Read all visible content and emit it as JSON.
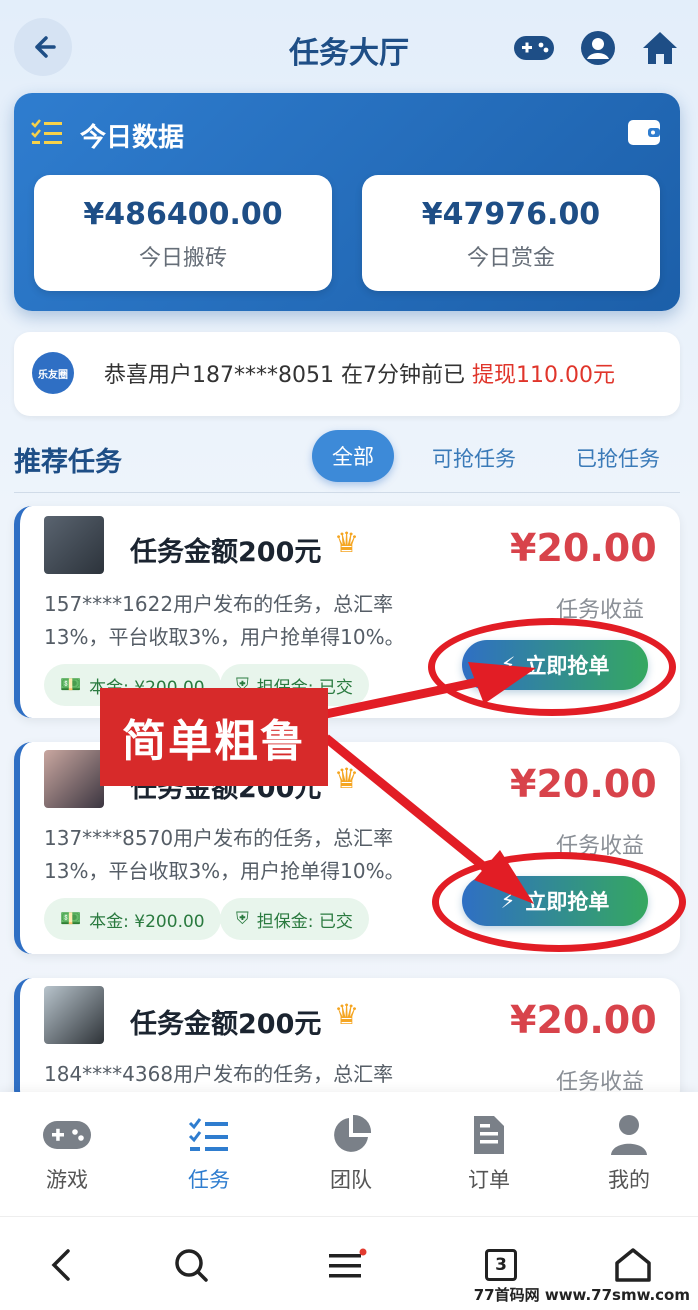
{
  "header": {
    "title": "任务大厅"
  },
  "stats": {
    "title": "今日数据",
    "items": [
      {
        "value": "¥486400.00",
        "label": "今日搬砖"
      },
      {
        "value": "¥47976.00",
        "label": "今日赏金"
      }
    ]
  },
  "notice": {
    "logo_text": "乐友圈",
    "text": "恭喜用户187****8051 在7分钟前已 ",
    "highlight": "提现110.00元"
  },
  "section": {
    "title": "推荐任务",
    "tabs": [
      "全部",
      "可抢任务",
      "已抢任务"
    ]
  },
  "tasks": [
    {
      "title": "任务金额200元",
      "price": "¥20.00",
      "earn_label": "任务收益",
      "desc": "157****1622用户发布的任务，总汇率13%，平台收取3%，用户抢单得10%。",
      "principal": "本金: ¥200.00",
      "deposit": "担保金: 已交",
      "button": "立即抢单"
    },
    {
      "title": "任务金额200元",
      "price": "¥20.00",
      "earn_label": "任务收益",
      "desc": "137****8570用户发布的任务，总汇率13%，平台收取3%，用户抢单得10%。",
      "principal": "本金: ¥200.00",
      "deposit": "担保金: 已交",
      "button": "立即抢单"
    },
    {
      "title": "任务金额200元",
      "price": "¥20.00",
      "earn_label": "任务收益",
      "desc": "184****4368用户发布的任务，总汇率"
    }
  ],
  "annotation": {
    "label": "简单粗鲁"
  },
  "nav": {
    "items": [
      {
        "label": "游戏",
        "icon": "gamepad-icon"
      },
      {
        "label": "任务",
        "icon": "task-list-icon"
      },
      {
        "label": "团队",
        "icon": "pie-chart-icon"
      },
      {
        "label": "订单",
        "icon": "document-icon"
      },
      {
        "label": "我的",
        "icon": "user-icon"
      }
    ],
    "active": "任务"
  },
  "browser": {
    "tab_count": "3"
  },
  "watermark": "77首码网 www.77smw.com",
  "colors": {
    "primary": "#2f7dcf",
    "price_red": "#d8434b",
    "annotation_red": "#e21d25",
    "button_green": "#35a860"
  }
}
